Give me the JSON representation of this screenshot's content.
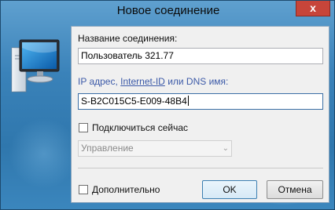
{
  "window": {
    "title": "Новое соединение",
    "close_glyph": "x"
  },
  "icon": {
    "name": "computer-monitor-icon"
  },
  "form": {
    "connection_name_label": "Название соединения:",
    "connection_name_value": "Пользователь 321.77",
    "address_label_prefix": "IP адрес, ",
    "address_label_link": "Internet-ID",
    "address_label_suffix": " или DNS имя:",
    "address_value": "S-B2C015C5-E009-48B4",
    "connect_now_label": "Подключиться сейчас",
    "connect_now_checked": false,
    "mode_selected": "Управление",
    "advanced_label": "Дополнительно",
    "advanced_checked": false
  },
  "buttons": {
    "ok": "OK",
    "cancel": "Отмена"
  },
  "colors": {
    "accent_link": "#3c5aa8",
    "close_button": "#c7453a",
    "panel": "#f0f0f0"
  }
}
